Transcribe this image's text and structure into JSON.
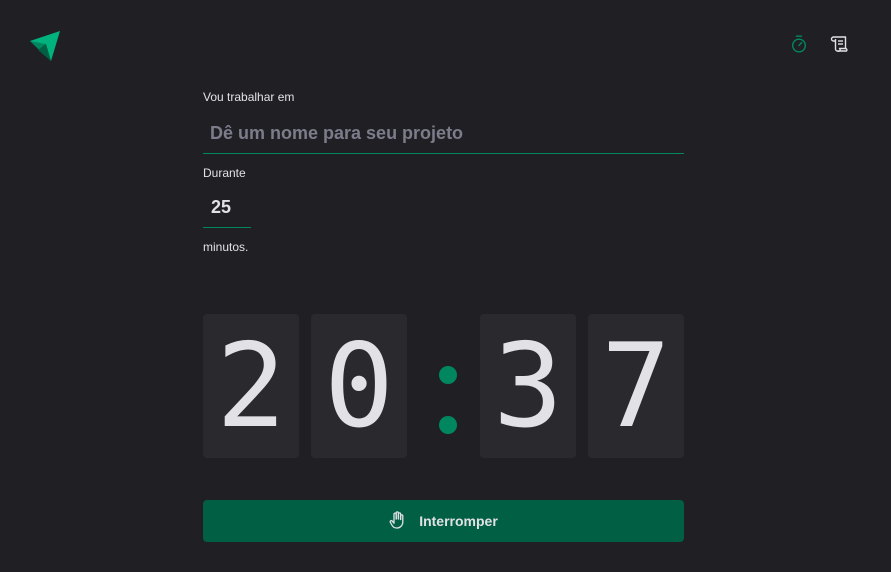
{
  "app": {
    "logo_icon": "ignite-logo-icon",
    "accent_color": "#00875f",
    "button_color": "#015f43",
    "background_color": "#202024"
  },
  "nav": {
    "items": [
      {
        "icon": "timer-icon",
        "active": true
      },
      {
        "icon": "scroll-history-icon",
        "active": false
      }
    ]
  },
  "form": {
    "task_label": "Vou trabalhar em",
    "task_placeholder": "Dê um nome para seu projeto",
    "task_value": "",
    "duration_label": "Durante",
    "duration_value": "25",
    "minutes_label": "minutos."
  },
  "countdown": {
    "minutes_tens": "2",
    "minutes_ones": "0",
    "separator": ":",
    "seconds_tens": "3",
    "seconds_ones": "7"
  },
  "stop_button": {
    "label": "Interromper",
    "icon": "hand-palm-icon"
  }
}
